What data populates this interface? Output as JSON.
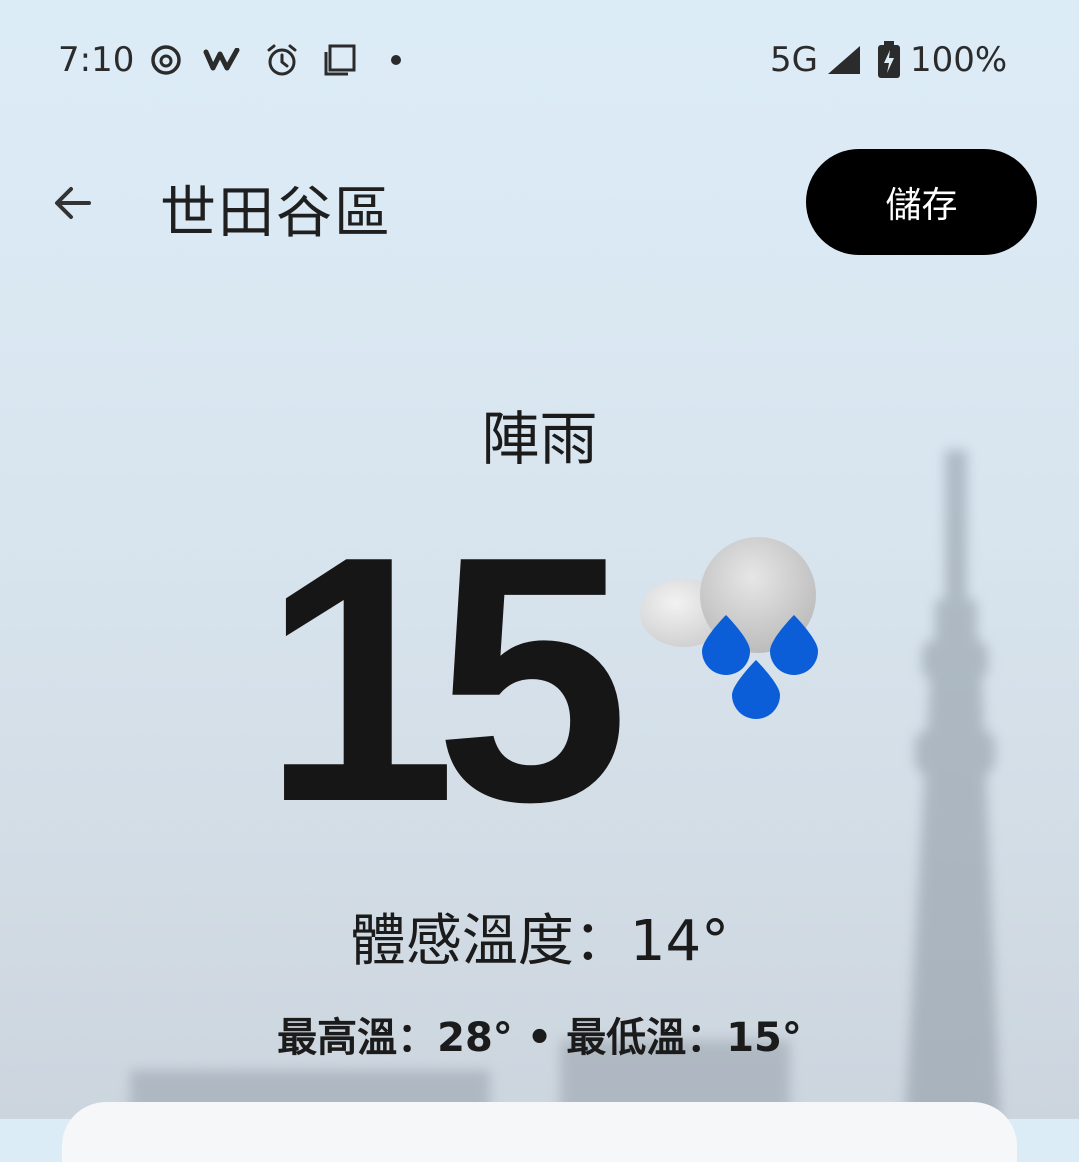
{
  "status_bar": {
    "time": "7:10",
    "icons": [
      "threads-icon",
      "w-app-icon",
      "alarm-icon",
      "screenshot-icon",
      "dot-icon"
    ],
    "network": "5G",
    "battery_percent": "100%"
  },
  "app_bar": {
    "back_icon": "arrow-left-icon",
    "title": "世田谷區",
    "save_label": "儲存"
  },
  "weather": {
    "condition": "陣雨",
    "temperature": "15",
    "icon": "cloud-rain-icon",
    "feels_like": "體感溫度：14°",
    "hi_lo": "最高溫：28° • 最低溫：15°"
  },
  "colors": {
    "rain_drop": "#0b5ed7",
    "button_bg": "#000000",
    "background_top": "#dcecf7"
  }
}
